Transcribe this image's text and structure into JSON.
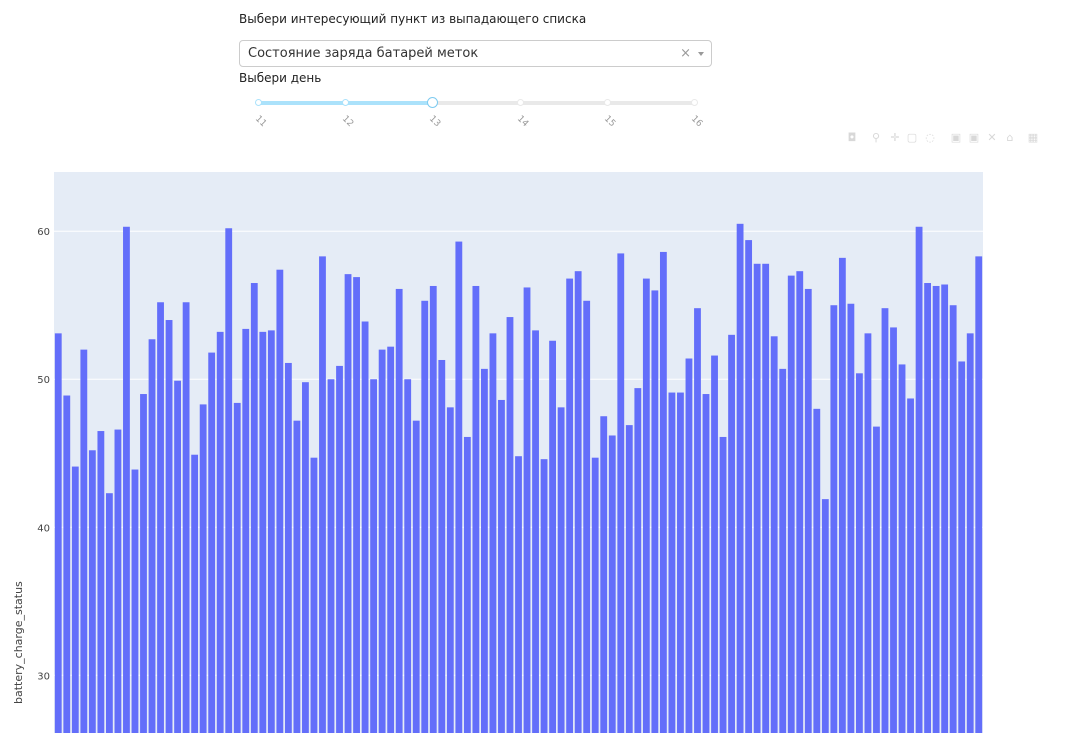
{
  "controls": {
    "prompt_label": "Выбери интересующий пункт из выпадающего списка",
    "dropdown_value": "Состояние заряда батарей меток",
    "clear_symbol": "×",
    "day_label": "Выбери день"
  },
  "slider": {
    "marks": [
      "11",
      "12",
      "13",
      "14",
      "15",
      "16"
    ],
    "selected": "13",
    "selected_index": 2,
    "colors": {
      "rail": "#e9e9e9",
      "track": "#abe2fb",
      "handle_border": "#7ecbf0"
    }
  },
  "modebar": {
    "icons": [
      "camera-icon",
      "zoom-icon",
      "pan-icon",
      "box-select-icon",
      "lasso-icon",
      "zoom-in-icon",
      "zoom-out-icon",
      "autoscale-icon",
      "reset-axes-icon",
      "plotly-logo-icon"
    ]
  },
  "chart_data": {
    "type": "bar",
    "ylabel": "battery_charge_status",
    "yticks": [
      30,
      40,
      50,
      60
    ],
    "ylim": [
      26.1,
      64
    ],
    "grid": true,
    "colors": {
      "bar": "#636efa",
      "plot_bg": "#e5ecf6",
      "grid": "#ffffff"
    },
    "values": [
      53.1,
      48.9,
      44.1,
      52.0,
      45.2,
      46.5,
      42.3,
      46.6,
      60.3,
      43.9,
      49.0,
      52.7,
      55.2,
      54.0,
      49.9,
      55.2,
      44.9,
      48.3,
      51.8,
      53.2,
      60.2,
      48.4,
      53.4,
      56.5,
      53.2,
      53.3,
      57.4,
      51.1,
      47.2,
      49.8,
      44.7,
      58.3,
      50.0,
      50.9,
      57.1,
      56.9,
      53.9,
      50.0,
      52.0,
      52.2,
      56.1,
      50.0,
      47.2,
      55.3,
      56.3,
      51.3,
      48.1,
      59.3,
      46.1,
      56.3,
      50.7,
      53.1,
      48.6,
      54.2,
      44.8,
      56.2,
      53.3,
      44.6,
      52.6,
      48.1,
      56.8,
      57.3,
      55.3,
      44.7,
      47.5,
      46.2,
      58.5,
      46.9,
      49.4,
      56.8,
      56.0,
      58.6,
      49.1,
      49.1,
      51.4,
      54.8,
      49.0,
      51.6,
      46.1,
      53.0,
      60.5,
      59.4,
      57.8,
      57.8,
      52.9,
      50.7,
      57.0,
      57.3,
      56.1,
      48.0,
      41.9,
      55.0,
      58.2,
      55.1,
      50.4,
      53.1,
      46.8,
      54.8,
      53.5,
      51.0,
      48.7,
      60.3,
      56.5,
      56.3,
      56.4,
      55.0,
      51.2,
      53.1,
      58.3
    ]
  }
}
